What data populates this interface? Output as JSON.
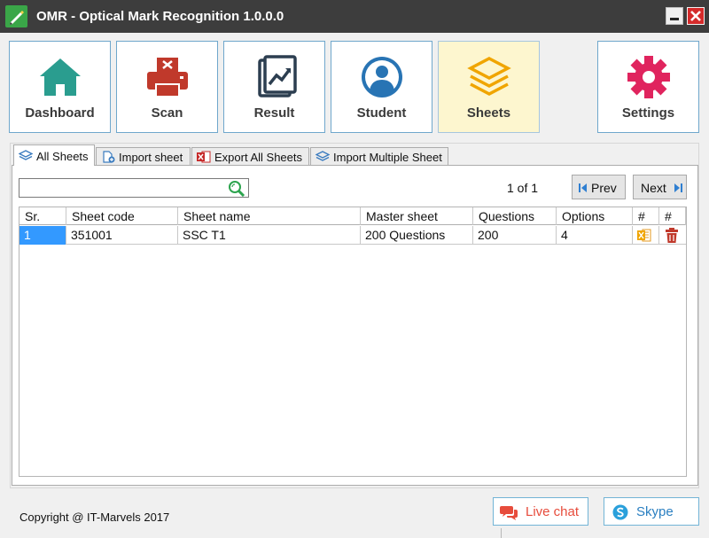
{
  "window": {
    "title": "OMR - Optical Mark Recognition 1.0.0.0"
  },
  "toolbar": [
    {
      "label": "Dashboard",
      "icon": "home-icon",
      "color": "#2a9d8f"
    },
    {
      "label": "Scan",
      "icon": "printer-icon",
      "color": "#c0392b"
    },
    {
      "label": "Result",
      "icon": "chart-icon",
      "color": "#2c3e50"
    },
    {
      "label": "Student",
      "icon": "user-icon",
      "color": "#2874b4"
    },
    {
      "label": "Sheets",
      "icon": "layers-icon",
      "color": "#f0a500",
      "active": true
    },
    {
      "label": "Settings",
      "icon": "gear-icon",
      "color": "#e0245e"
    }
  ],
  "tabs": [
    {
      "label": "All Sheets",
      "icon": "layers-icon",
      "active": true
    },
    {
      "label": "Import sheet",
      "icon": "add-file-icon"
    },
    {
      "label": "Export All Sheets",
      "icon": "excel-icon"
    },
    {
      "label": "Import Multiple Sheet",
      "icon": "layers-icon"
    }
  ],
  "search": {
    "value": "",
    "placeholder": ""
  },
  "pager": {
    "text": "1 of 1",
    "prev": "Prev",
    "next": "Next"
  },
  "grid": {
    "columns": [
      "Sr.",
      "Sheet code",
      "Sheet name",
      "Master sheet",
      "Questions",
      "Options",
      "#",
      "#"
    ],
    "rows": [
      {
        "sr": "1",
        "code": "351001",
        "name": "SSC T1",
        "master": "200 Questions",
        "questions": "200",
        "options": "4",
        "export_icon": "excel-icon",
        "delete_icon": "trash-icon"
      }
    ]
  },
  "footer": {
    "copyright": "Copyright @ IT-Marvels 2017",
    "live_chat": "Live chat",
    "skype": "Skype"
  },
  "colors": {
    "accent_border": "#6fa7cc",
    "active_bg": "#fdf6cf",
    "selection": "#3399ff",
    "titlebar": "#3d3d3d"
  }
}
